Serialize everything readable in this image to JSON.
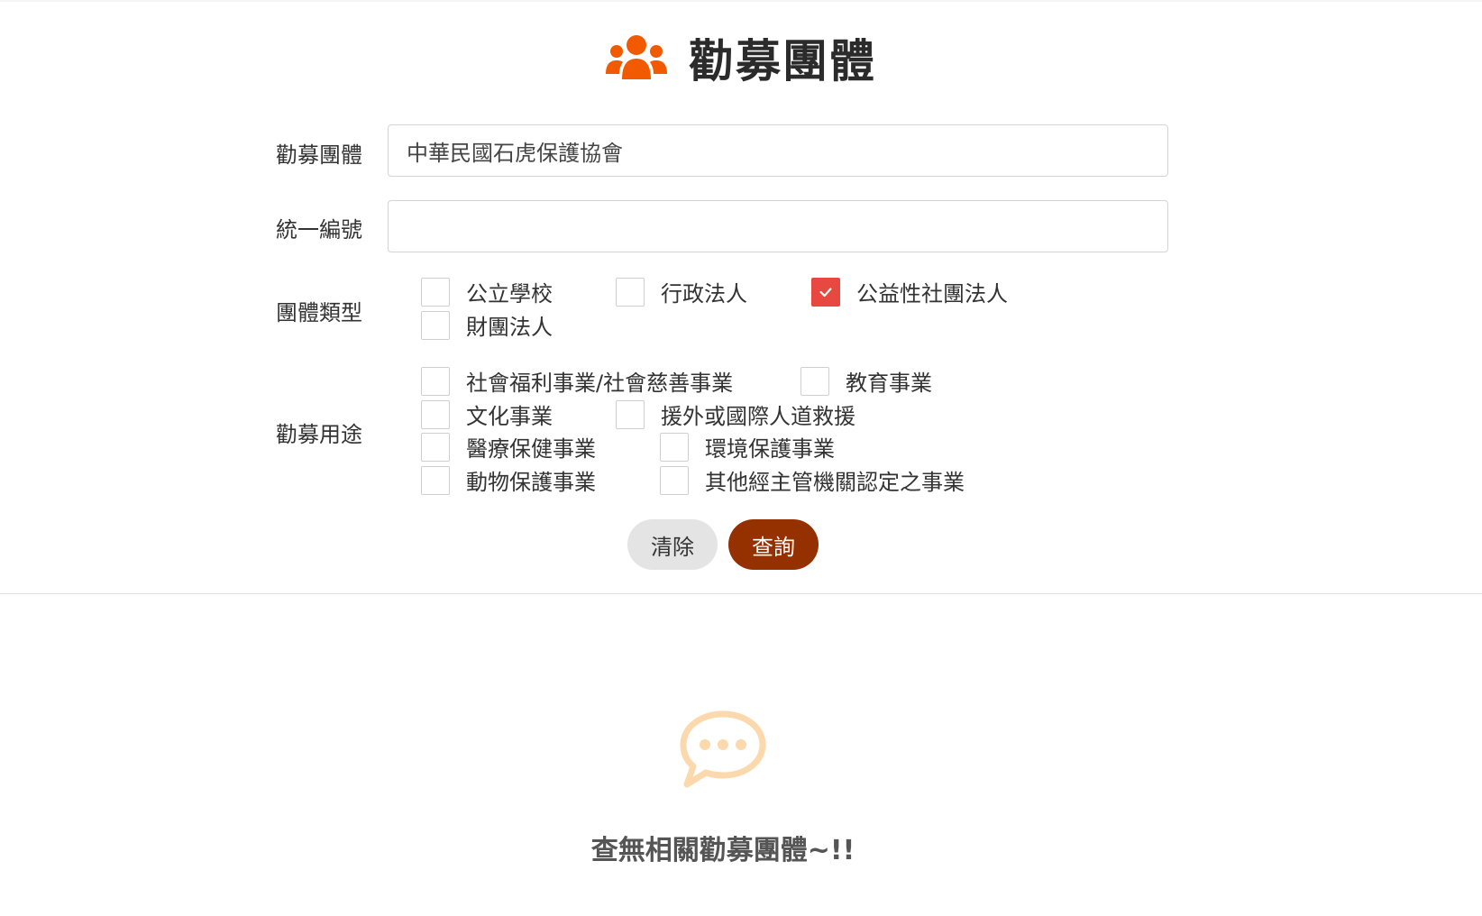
{
  "header": {
    "title": "勸募團體",
    "icon": "users-icon",
    "icon_color": "#f25a00"
  },
  "form": {
    "org": {
      "label": "勸募團體",
      "value": "中華民國石虎保護協會"
    },
    "tax_id": {
      "label": "統一編號",
      "value": ""
    },
    "org_type": {
      "label": "團體類型",
      "options": [
        {
          "label": "公立學校",
          "checked": false
        },
        {
          "label": "行政法人",
          "checked": false
        },
        {
          "label": "公益性社團法人",
          "checked": true
        },
        {
          "label": "財團法人",
          "checked": false
        }
      ]
    },
    "purpose": {
      "label": "勸募用途",
      "options": [
        {
          "label": "社會福利事業/社會慈善事業",
          "checked": false
        },
        {
          "label": "教育事業",
          "checked": false
        },
        {
          "label": "文化事業",
          "checked": false
        },
        {
          "label": "援外或國際人道救援",
          "checked": false
        },
        {
          "label": "醫療保健事業",
          "checked": false
        },
        {
          "label": "環境保護事業",
          "checked": false
        },
        {
          "label": "動物保護事業",
          "checked": false
        },
        {
          "label": "其他經主管機關認定之事業",
          "checked": false
        }
      ]
    },
    "buttons": {
      "clear_label": "清除",
      "search_label": "查詢"
    }
  },
  "empty_state": {
    "icon": "chat-bubble-icon",
    "icon_color": "#fbd9ad",
    "message": "查無相關勸募團體~!!"
  },
  "colors": {
    "checkbox_checked": "#e8483f",
    "primary_button": "#953000"
  }
}
